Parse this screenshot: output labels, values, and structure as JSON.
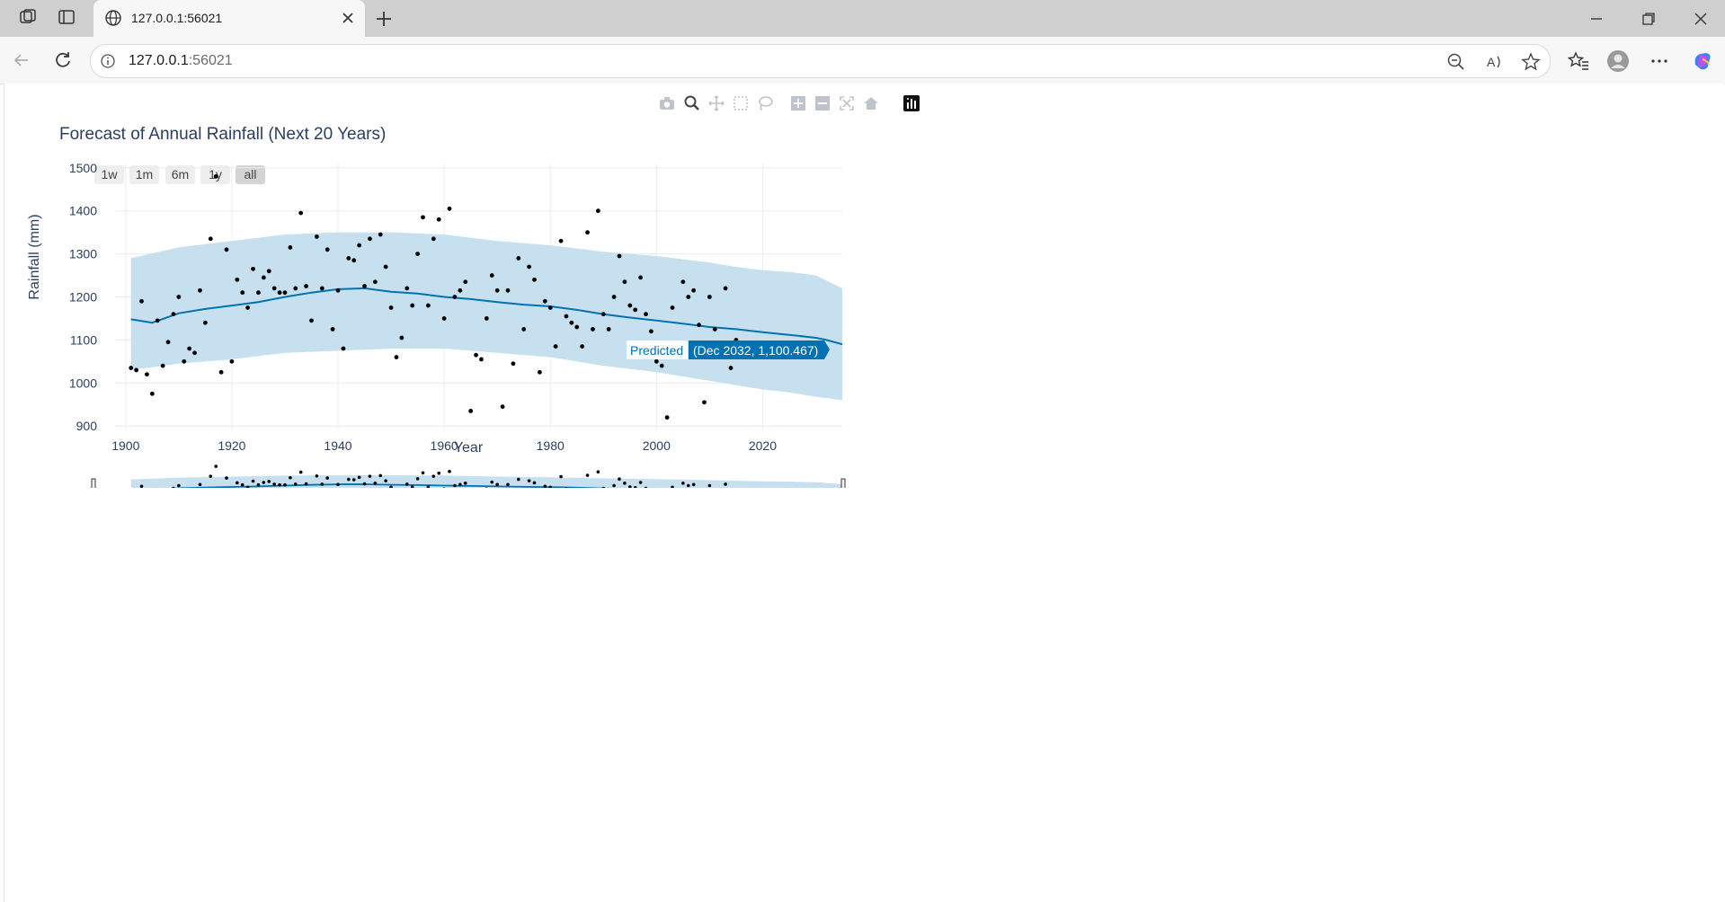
{
  "browser": {
    "tab_title": "127.0.0.1:56021",
    "url_host": "127.0.0.1",
    "url_port": ":56021",
    "icons": [
      "workspaces-icon",
      "tab-actions-icon",
      "globe-icon",
      "close-tab-icon",
      "new-tab-icon",
      "minimize-icon",
      "restore-icon",
      "close-window-icon",
      "back-icon",
      "refresh-icon",
      "info-icon",
      "zoom-out-icon",
      "read-aloud-icon",
      "favorite-icon",
      "favorites-icon",
      "profile-icon",
      "more-icon",
      "copilot-icon"
    ]
  },
  "modebar": {
    "icons": [
      "camera-icon",
      "zoom-icon",
      "pan-icon",
      "box-select-icon",
      "lasso-select-icon",
      "zoom-in-icon",
      "zoom-out-icon",
      "autoscale-icon",
      "reset-axes-icon",
      "plotly-logo-icon"
    ]
  },
  "chart": {
    "title": "Forecast of Annual Rainfall (Next 20 Years)",
    "range_buttons": [
      "1w",
      "1m",
      "6m",
      "1y",
      "all"
    ],
    "active_range_button": "all",
    "hover": {
      "series": "Predicted",
      "value": "(Dec 2032, 1,100.467)"
    },
    "colors": {
      "line": "#0072B2",
      "band": "#c6e0ef",
      "points": "#000000",
      "hover_bg": "#0072B2"
    }
  },
  "chart_data": {
    "type": "line",
    "title": "Forecast of Annual Rainfall (Next 20 Years)",
    "xlabel": "Year",
    "ylabel": "Rainfall (mm)",
    "xlim": [
      1898,
      2035
    ],
    "ylim": [
      890,
      1510
    ],
    "x_ticks": [
      "1900",
      "1920",
      "1940",
      "1960",
      "1980",
      "2000",
      "2020"
    ],
    "y_ticks": [
      "900",
      "1000",
      "1100",
      "1200",
      "1300",
      "1400",
      "1500"
    ],
    "grid": true,
    "legend": "none",
    "actual": {
      "x": [
        1901,
        1902,
        1903,
        1904,
        1905,
        1906,
        1907,
        1908,
        1909,
        1910,
        1911,
        1912,
        1913,
        1914,
        1915,
        1916,
        1917,
        1918,
        1919,
        1920,
        1921,
        1922,
        1923,
        1924,
        1925,
        1926,
        1927,
        1928,
        1929,
        1930,
        1931,
        1932,
        1933,
        1934,
        1935,
        1936,
        1937,
        1938,
        1939,
        1940,
        1941,
        1942,
        1943,
        1944,
        1945,
        1946,
        1947,
        1948,
        1949,
        1950,
        1951,
        1952,
        1953,
        1954,
        1955,
        1956,
        1957,
        1958,
        1959,
        1960,
        1961,
        1962,
        1963,
        1964,
        1965,
        1966,
        1967,
        1968,
        1969,
        1970,
        1971,
        1972,
        1973,
        1974,
        1975,
        1976,
        1977,
        1978,
        1979,
        1980,
        1981,
        1982,
        1983,
        1984,
        1985,
        1986,
        1987,
        1988,
        1989,
        1990,
        1991,
        1992,
        1993,
        1994,
        1995,
        1996,
        1997,
        1998,
        1999,
        2000,
        2001,
        2002,
        2003,
        2004,
        2005,
        2006,
        2007,
        2008,
        2009,
        2010,
        2011,
        2012,
        2013,
        2014,
        2015
      ],
      "y": [
        1035,
        1030,
        1190,
        1020,
        975,
        1145,
        1040,
        1095,
        1160,
        1200,
        1050,
        1080,
        1070,
        1215,
        1140,
        1335,
        1480,
        1025,
        1310,
        1050,
        1240,
        1210,
        1175,
        1265,
        1210,
        1245,
        1260,
        1220,
        1210,
        1210,
        1315,
        1220,
        1395,
        1225,
        1145,
        1340,
        1220,
        1310,
        1125,
        1215,
        1080,
        1290,
        1285,
        1320,
        1225,
        1335,
        1235,
        1345,
        1270,
        1175,
        1060,
        1105,
        1220,
        1180,
        1300,
        1385,
        1180,
        1335,
        1380,
        1150,
        1405,
        1200,
        1215,
        1235,
        935,
        1065,
        1055,
        1150,
        1250,
        1215,
        945,
        1215,
        1045,
        1290,
        1125,
        1270,
        1240,
        1025,
        1190,
        1175,
        1085,
        1330,
        1155,
        1140,
        1130,
        1085,
        1350,
        1125,
        1400,
        1160,
        1125,
        1200,
        1295,
        1235,
        1180,
        1170,
        1245,
        1160,
        1120,
        1050,
        1040,
        920,
        1175,
        1070,
        1235,
        1200,
        1215,
        1135,
        955,
        1200,
        1125,
        1075,
        1220,
        1035,
        1100
      ]
    },
    "predicted": {
      "x": [
        1901,
        1905,
        1910,
        1915,
        1920,
        1925,
        1930,
        1935,
        1940,
        1945,
        1950,
        1955,
        1960,
        1965,
        1970,
        1975,
        1980,
        1985,
        1990,
        1995,
        2000,
        2005,
        2010,
        2015,
        2020,
        2025,
        2030,
        2032,
        2035
      ],
      "y": [
        1148,
        1140,
        1162,
        1172,
        1180,
        1188,
        1200,
        1210,
        1218,
        1220,
        1212,
        1208,
        1200,
        1195,
        1188,
        1182,
        1178,
        1170,
        1160,
        1152,
        1145,
        1138,
        1130,
        1125,
        1118,
        1112,
        1105,
        1100,
        1090
      ]
    },
    "upper_bound": {
      "x": [
        1901,
        1910,
        1920,
        1930,
        1940,
        1950,
        1960,
        1970,
        1980,
        1990,
        2000,
        2010,
        2015,
        2020,
        2025,
        2030,
        2035
      ],
      "y": [
        1290,
        1315,
        1330,
        1345,
        1350,
        1350,
        1345,
        1330,
        1320,
        1305,
        1295,
        1280,
        1270,
        1262,
        1258,
        1250,
        1220
      ]
    },
    "lower_bound": {
      "x": [
        1901,
        1910,
        1920,
        1930,
        1940,
        1950,
        1960,
        1970,
        1980,
        1990,
        2000,
        2010,
        2015,
        2020,
        2025,
        2030,
        2035
      ],
      "y": [
        1030,
        1045,
        1055,
        1070,
        1075,
        1080,
        1080,
        1070,
        1060,
        1040,
        1025,
        1005,
        995,
        985,
        978,
        968,
        960
      ]
    },
    "hover_point": {
      "series": "Predicted",
      "x": "Dec 2032",
      "y": 1100.467
    }
  }
}
